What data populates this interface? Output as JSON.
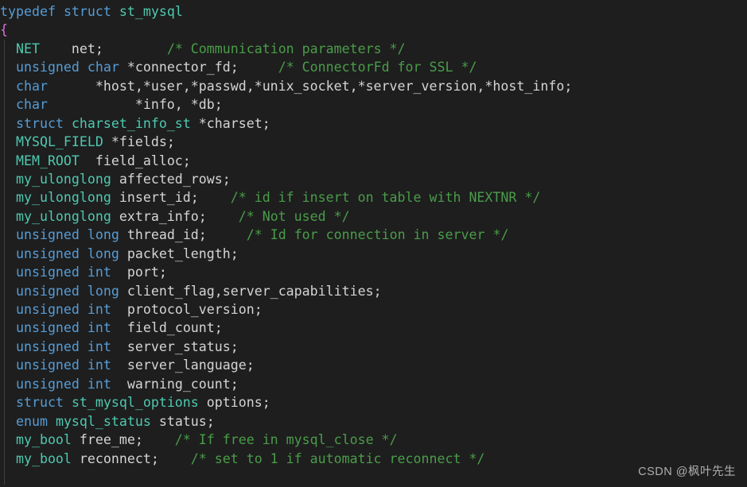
{
  "editor": {
    "background": "#1e1e1e",
    "default_text_color": "#d4d4d4",
    "indent_guide_color": "#404040",
    "colors": {
      "keyword": "#569cd6",
      "type": "#4ec9b0",
      "identifier": "#d4d4d4",
      "comment": "#4a9c4a",
      "bracket": "#da70d6"
    },
    "language": "C"
  },
  "watermark": {
    "text": "CSDN @枫叶先生"
  },
  "code": {
    "lines": [
      {
        "n": 1,
        "text": "typedef struct st_mysql",
        "tokens": [
          {
            "t": "typedef",
            "c": "kw"
          },
          {
            "t": " ",
            "c": "id"
          },
          {
            "t": "struct",
            "c": "kw"
          },
          {
            "t": " ",
            "c": "id"
          },
          {
            "t": "st_mysql",
            "c": "typ"
          }
        ]
      },
      {
        "n": 2,
        "text": "{",
        "tokens": [
          {
            "t": "{",
            "c": "br1"
          }
        ]
      },
      {
        "n": 3,
        "text": "  NET    net;        /* Communication parameters */",
        "tokens": [
          {
            "t": "  ",
            "c": "id"
          },
          {
            "t": "NET",
            "c": "typ"
          },
          {
            "t": "    net;        ",
            "c": "id"
          },
          {
            "t": "/* Communication parameters */",
            "c": "cmt"
          }
        ]
      },
      {
        "n": 4,
        "text": "  unsigned char *connector_fd;     /* ConnectorFd for SSL */",
        "tokens": [
          {
            "t": "  ",
            "c": "id"
          },
          {
            "t": "unsigned",
            "c": "kw"
          },
          {
            "t": " ",
            "c": "id"
          },
          {
            "t": "char",
            "c": "kw"
          },
          {
            "t": " *connector_fd;     ",
            "c": "id"
          },
          {
            "t": "/* ConnectorFd for SSL */",
            "c": "cmt"
          }
        ]
      },
      {
        "n": 5,
        "text": "  char      *host,*user,*passwd,*unix_socket,*server_version,*host_info;",
        "tokens": [
          {
            "t": "  ",
            "c": "id"
          },
          {
            "t": "char",
            "c": "kw"
          },
          {
            "t": "      *host,*user,*passwd,*unix_socket,*server_version,*host_info;",
            "c": "id"
          }
        ]
      },
      {
        "n": 6,
        "text": "  char           *info, *db;",
        "tokens": [
          {
            "t": "  ",
            "c": "id"
          },
          {
            "t": "char",
            "c": "kw"
          },
          {
            "t": "           *info, *db;",
            "c": "id"
          }
        ]
      },
      {
        "n": 7,
        "text": "  struct charset_info_st *charset;",
        "tokens": [
          {
            "t": "  ",
            "c": "id"
          },
          {
            "t": "struct",
            "c": "kw"
          },
          {
            "t": " ",
            "c": "id"
          },
          {
            "t": "charset_info_st",
            "c": "typ"
          },
          {
            "t": " *charset;",
            "c": "id"
          }
        ]
      },
      {
        "n": 8,
        "text": "  MYSQL_FIELD *fields;",
        "tokens": [
          {
            "t": "  ",
            "c": "id"
          },
          {
            "t": "MYSQL_FIELD",
            "c": "typ"
          },
          {
            "t": " *fields;",
            "c": "id"
          }
        ]
      },
      {
        "n": 9,
        "text": "  MEM_ROOT  field_alloc;",
        "tokens": [
          {
            "t": "  ",
            "c": "id"
          },
          {
            "t": "MEM_ROOT",
            "c": "typ"
          },
          {
            "t": "  field_alloc;",
            "c": "id"
          }
        ]
      },
      {
        "n": 10,
        "text": "  my_ulonglong affected_rows;",
        "tokens": [
          {
            "t": "  ",
            "c": "id"
          },
          {
            "t": "my_ulonglong",
            "c": "typ"
          },
          {
            "t": " affected_rows;",
            "c": "id"
          }
        ]
      },
      {
        "n": 11,
        "text": "  my_ulonglong insert_id;    /* id if insert on table with NEXTNR */",
        "tokens": [
          {
            "t": "  ",
            "c": "id"
          },
          {
            "t": "my_ulonglong",
            "c": "typ"
          },
          {
            "t": " insert_id;    ",
            "c": "id"
          },
          {
            "t": "/* id if insert on table with NEXTNR */",
            "c": "cmt"
          }
        ]
      },
      {
        "n": 12,
        "text": "  my_ulonglong extra_info;    /* Not used */",
        "tokens": [
          {
            "t": "  ",
            "c": "id"
          },
          {
            "t": "my_ulonglong",
            "c": "typ"
          },
          {
            "t": " extra_info;    ",
            "c": "id"
          },
          {
            "t": "/* Not used */",
            "c": "cmt"
          }
        ]
      },
      {
        "n": 13,
        "text": "  unsigned long thread_id;     /* Id for connection in server */",
        "tokens": [
          {
            "t": "  ",
            "c": "id"
          },
          {
            "t": "unsigned",
            "c": "kw"
          },
          {
            "t": " ",
            "c": "id"
          },
          {
            "t": "long",
            "c": "kw"
          },
          {
            "t": " thread_id;     ",
            "c": "id"
          },
          {
            "t": "/* Id for connection in server */",
            "c": "cmt"
          }
        ]
      },
      {
        "n": 14,
        "text": "  unsigned long packet_length;",
        "tokens": [
          {
            "t": "  ",
            "c": "id"
          },
          {
            "t": "unsigned",
            "c": "kw"
          },
          {
            "t": " ",
            "c": "id"
          },
          {
            "t": "long",
            "c": "kw"
          },
          {
            "t": " packet_length;",
            "c": "id"
          }
        ]
      },
      {
        "n": 15,
        "text": "  unsigned int  port;",
        "tokens": [
          {
            "t": "  ",
            "c": "id"
          },
          {
            "t": "unsigned",
            "c": "kw"
          },
          {
            "t": " ",
            "c": "id"
          },
          {
            "t": "int",
            "c": "kw"
          },
          {
            "t": "  port;",
            "c": "id"
          }
        ]
      },
      {
        "n": 16,
        "text": "  unsigned long client_flag,server_capabilities;",
        "tokens": [
          {
            "t": "  ",
            "c": "id"
          },
          {
            "t": "unsigned",
            "c": "kw"
          },
          {
            "t": " ",
            "c": "id"
          },
          {
            "t": "long",
            "c": "kw"
          },
          {
            "t": " client_flag,server_capabilities;",
            "c": "id"
          }
        ]
      },
      {
        "n": 17,
        "text": "  unsigned int  protocol_version;",
        "tokens": [
          {
            "t": "  ",
            "c": "id"
          },
          {
            "t": "unsigned",
            "c": "kw"
          },
          {
            "t": " ",
            "c": "id"
          },
          {
            "t": "int",
            "c": "kw"
          },
          {
            "t": "  protocol_version;",
            "c": "id"
          }
        ]
      },
      {
        "n": 18,
        "text": "  unsigned int  field_count;",
        "tokens": [
          {
            "t": "  ",
            "c": "id"
          },
          {
            "t": "unsigned",
            "c": "kw"
          },
          {
            "t": " ",
            "c": "id"
          },
          {
            "t": "int",
            "c": "kw"
          },
          {
            "t": "  field_count;",
            "c": "id"
          }
        ]
      },
      {
        "n": 19,
        "text": "  unsigned int  server_status;",
        "tokens": [
          {
            "t": "  ",
            "c": "id"
          },
          {
            "t": "unsigned",
            "c": "kw"
          },
          {
            "t": " ",
            "c": "id"
          },
          {
            "t": "int",
            "c": "kw"
          },
          {
            "t": "  server_status;",
            "c": "id"
          }
        ]
      },
      {
        "n": 20,
        "text": "  unsigned int  server_language;",
        "tokens": [
          {
            "t": "  ",
            "c": "id"
          },
          {
            "t": "unsigned",
            "c": "kw"
          },
          {
            "t": " ",
            "c": "id"
          },
          {
            "t": "int",
            "c": "kw"
          },
          {
            "t": "  server_language;",
            "c": "id"
          }
        ]
      },
      {
        "n": 21,
        "text": "  unsigned int  warning_count;",
        "tokens": [
          {
            "t": "  ",
            "c": "id"
          },
          {
            "t": "unsigned",
            "c": "kw"
          },
          {
            "t": " ",
            "c": "id"
          },
          {
            "t": "int",
            "c": "kw"
          },
          {
            "t": "  warning_count;",
            "c": "id"
          }
        ]
      },
      {
        "n": 22,
        "text": "  struct st_mysql_options options;",
        "tokens": [
          {
            "t": "  ",
            "c": "id"
          },
          {
            "t": "struct",
            "c": "kw"
          },
          {
            "t": " ",
            "c": "id"
          },
          {
            "t": "st_mysql_options",
            "c": "typ"
          },
          {
            "t": " options;",
            "c": "id"
          }
        ]
      },
      {
        "n": 23,
        "text": "  enum mysql_status status;",
        "tokens": [
          {
            "t": "  ",
            "c": "id"
          },
          {
            "t": "enum",
            "c": "kw"
          },
          {
            "t": " ",
            "c": "id"
          },
          {
            "t": "mysql_status",
            "c": "typ"
          },
          {
            "t": " status;",
            "c": "id"
          }
        ]
      },
      {
        "n": 24,
        "text": "  my_bool free_me;    /* If free in mysql_close */",
        "tokens": [
          {
            "t": "  ",
            "c": "id"
          },
          {
            "t": "my_bool",
            "c": "typ"
          },
          {
            "t": " free_me;    ",
            "c": "id"
          },
          {
            "t": "/* If free in mysql_close */",
            "c": "cmt"
          }
        ]
      },
      {
        "n": 25,
        "text": "  my_bool reconnect;    /* set to 1 if automatic reconnect */",
        "tokens": [
          {
            "t": "  ",
            "c": "id"
          },
          {
            "t": "my_bool",
            "c": "typ"
          },
          {
            "t": " reconnect;    ",
            "c": "id"
          },
          {
            "t": "/* set to 1 if automatic reconnect */",
            "c": "cmt"
          }
        ]
      }
    ]
  }
}
